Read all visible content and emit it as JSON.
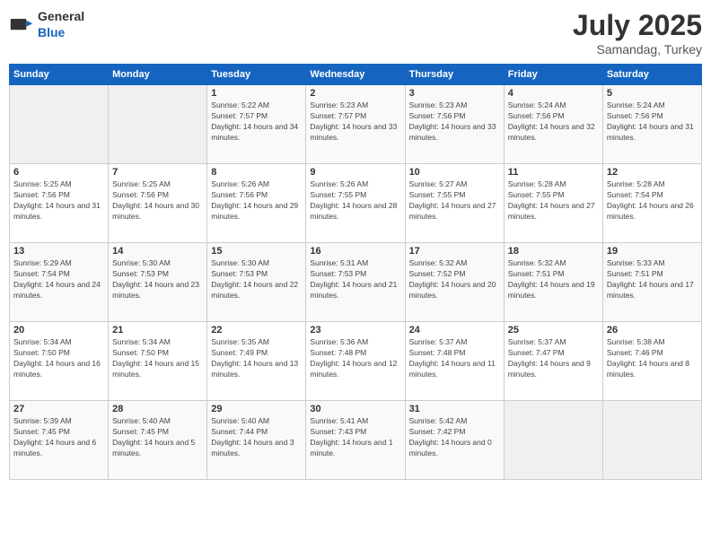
{
  "logo": {
    "general": "General",
    "blue": "Blue"
  },
  "header": {
    "month": "July 2025",
    "location": "Samandag, Turkey"
  },
  "weekdays": [
    "Sunday",
    "Monday",
    "Tuesday",
    "Wednesday",
    "Thursday",
    "Friday",
    "Saturday"
  ],
  "weeks": [
    [
      {
        "day": "",
        "empty": true
      },
      {
        "day": "",
        "empty": true
      },
      {
        "day": "1",
        "sunrise": "Sunrise: 5:22 AM",
        "sunset": "Sunset: 7:57 PM",
        "daylight": "Daylight: 14 hours and 34 minutes."
      },
      {
        "day": "2",
        "sunrise": "Sunrise: 5:23 AM",
        "sunset": "Sunset: 7:57 PM",
        "daylight": "Daylight: 14 hours and 33 minutes."
      },
      {
        "day": "3",
        "sunrise": "Sunrise: 5:23 AM",
        "sunset": "Sunset: 7:56 PM",
        "daylight": "Daylight: 14 hours and 33 minutes."
      },
      {
        "day": "4",
        "sunrise": "Sunrise: 5:24 AM",
        "sunset": "Sunset: 7:56 PM",
        "daylight": "Daylight: 14 hours and 32 minutes."
      },
      {
        "day": "5",
        "sunrise": "Sunrise: 5:24 AM",
        "sunset": "Sunset: 7:56 PM",
        "daylight": "Daylight: 14 hours and 31 minutes."
      }
    ],
    [
      {
        "day": "6",
        "sunrise": "Sunrise: 5:25 AM",
        "sunset": "Sunset: 7:56 PM",
        "daylight": "Daylight: 14 hours and 31 minutes."
      },
      {
        "day": "7",
        "sunrise": "Sunrise: 5:25 AM",
        "sunset": "Sunset: 7:56 PM",
        "daylight": "Daylight: 14 hours and 30 minutes."
      },
      {
        "day": "8",
        "sunrise": "Sunrise: 5:26 AM",
        "sunset": "Sunset: 7:56 PM",
        "daylight": "Daylight: 14 hours and 29 minutes."
      },
      {
        "day": "9",
        "sunrise": "Sunrise: 5:26 AM",
        "sunset": "Sunset: 7:55 PM",
        "daylight": "Daylight: 14 hours and 28 minutes."
      },
      {
        "day": "10",
        "sunrise": "Sunrise: 5:27 AM",
        "sunset": "Sunset: 7:55 PM",
        "daylight": "Daylight: 14 hours and 27 minutes."
      },
      {
        "day": "11",
        "sunrise": "Sunrise: 5:28 AM",
        "sunset": "Sunset: 7:55 PM",
        "daylight": "Daylight: 14 hours and 27 minutes."
      },
      {
        "day": "12",
        "sunrise": "Sunrise: 5:28 AM",
        "sunset": "Sunset: 7:54 PM",
        "daylight": "Daylight: 14 hours and 26 minutes."
      }
    ],
    [
      {
        "day": "13",
        "sunrise": "Sunrise: 5:29 AM",
        "sunset": "Sunset: 7:54 PM",
        "daylight": "Daylight: 14 hours and 24 minutes."
      },
      {
        "day": "14",
        "sunrise": "Sunrise: 5:30 AM",
        "sunset": "Sunset: 7:53 PM",
        "daylight": "Daylight: 14 hours and 23 minutes."
      },
      {
        "day": "15",
        "sunrise": "Sunrise: 5:30 AM",
        "sunset": "Sunset: 7:53 PM",
        "daylight": "Daylight: 14 hours and 22 minutes."
      },
      {
        "day": "16",
        "sunrise": "Sunrise: 5:31 AM",
        "sunset": "Sunset: 7:53 PM",
        "daylight": "Daylight: 14 hours and 21 minutes."
      },
      {
        "day": "17",
        "sunrise": "Sunrise: 5:32 AM",
        "sunset": "Sunset: 7:52 PM",
        "daylight": "Daylight: 14 hours and 20 minutes."
      },
      {
        "day": "18",
        "sunrise": "Sunrise: 5:32 AM",
        "sunset": "Sunset: 7:51 PM",
        "daylight": "Daylight: 14 hours and 19 minutes."
      },
      {
        "day": "19",
        "sunrise": "Sunrise: 5:33 AM",
        "sunset": "Sunset: 7:51 PM",
        "daylight": "Daylight: 14 hours and 17 minutes."
      }
    ],
    [
      {
        "day": "20",
        "sunrise": "Sunrise: 5:34 AM",
        "sunset": "Sunset: 7:50 PM",
        "daylight": "Daylight: 14 hours and 16 minutes."
      },
      {
        "day": "21",
        "sunrise": "Sunrise: 5:34 AM",
        "sunset": "Sunset: 7:50 PM",
        "daylight": "Daylight: 14 hours and 15 minutes."
      },
      {
        "day": "22",
        "sunrise": "Sunrise: 5:35 AM",
        "sunset": "Sunset: 7:49 PM",
        "daylight": "Daylight: 14 hours and 13 minutes."
      },
      {
        "day": "23",
        "sunrise": "Sunrise: 5:36 AM",
        "sunset": "Sunset: 7:48 PM",
        "daylight": "Daylight: 14 hours and 12 minutes."
      },
      {
        "day": "24",
        "sunrise": "Sunrise: 5:37 AM",
        "sunset": "Sunset: 7:48 PM",
        "daylight": "Daylight: 14 hours and 11 minutes."
      },
      {
        "day": "25",
        "sunrise": "Sunrise: 5:37 AM",
        "sunset": "Sunset: 7:47 PM",
        "daylight": "Daylight: 14 hours and 9 minutes."
      },
      {
        "day": "26",
        "sunrise": "Sunrise: 5:38 AM",
        "sunset": "Sunset: 7:46 PM",
        "daylight": "Daylight: 14 hours and 8 minutes."
      }
    ],
    [
      {
        "day": "27",
        "sunrise": "Sunrise: 5:39 AM",
        "sunset": "Sunset: 7:45 PM",
        "daylight": "Daylight: 14 hours and 6 minutes."
      },
      {
        "day": "28",
        "sunrise": "Sunrise: 5:40 AM",
        "sunset": "Sunset: 7:45 PM",
        "daylight": "Daylight: 14 hours and 5 minutes."
      },
      {
        "day": "29",
        "sunrise": "Sunrise: 5:40 AM",
        "sunset": "Sunset: 7:44 PM",
        "daylight": "Daylight: 14 hours and 3 minutes."
      },
      {
        "day": "30",
        "sunrise": "Sunrise: 5:41 AM",
        "sunset": "Sunset: 7:43 PM",
        "daylight": "Daylight: 14 hours and 1 minute."
      },
      {
        "day": "31",
        "sunrise": "Sunrise: 5:42 AM",
        "sunset": "Sunset: 7:42 PM",
        "daylight": "Daylight: 14 hours and 0 minutes."
      },
      {
        "day": "",
        "empty": true
      },
      {
        "day": "",
        "empty": true
      }
    ]
  ]
}
